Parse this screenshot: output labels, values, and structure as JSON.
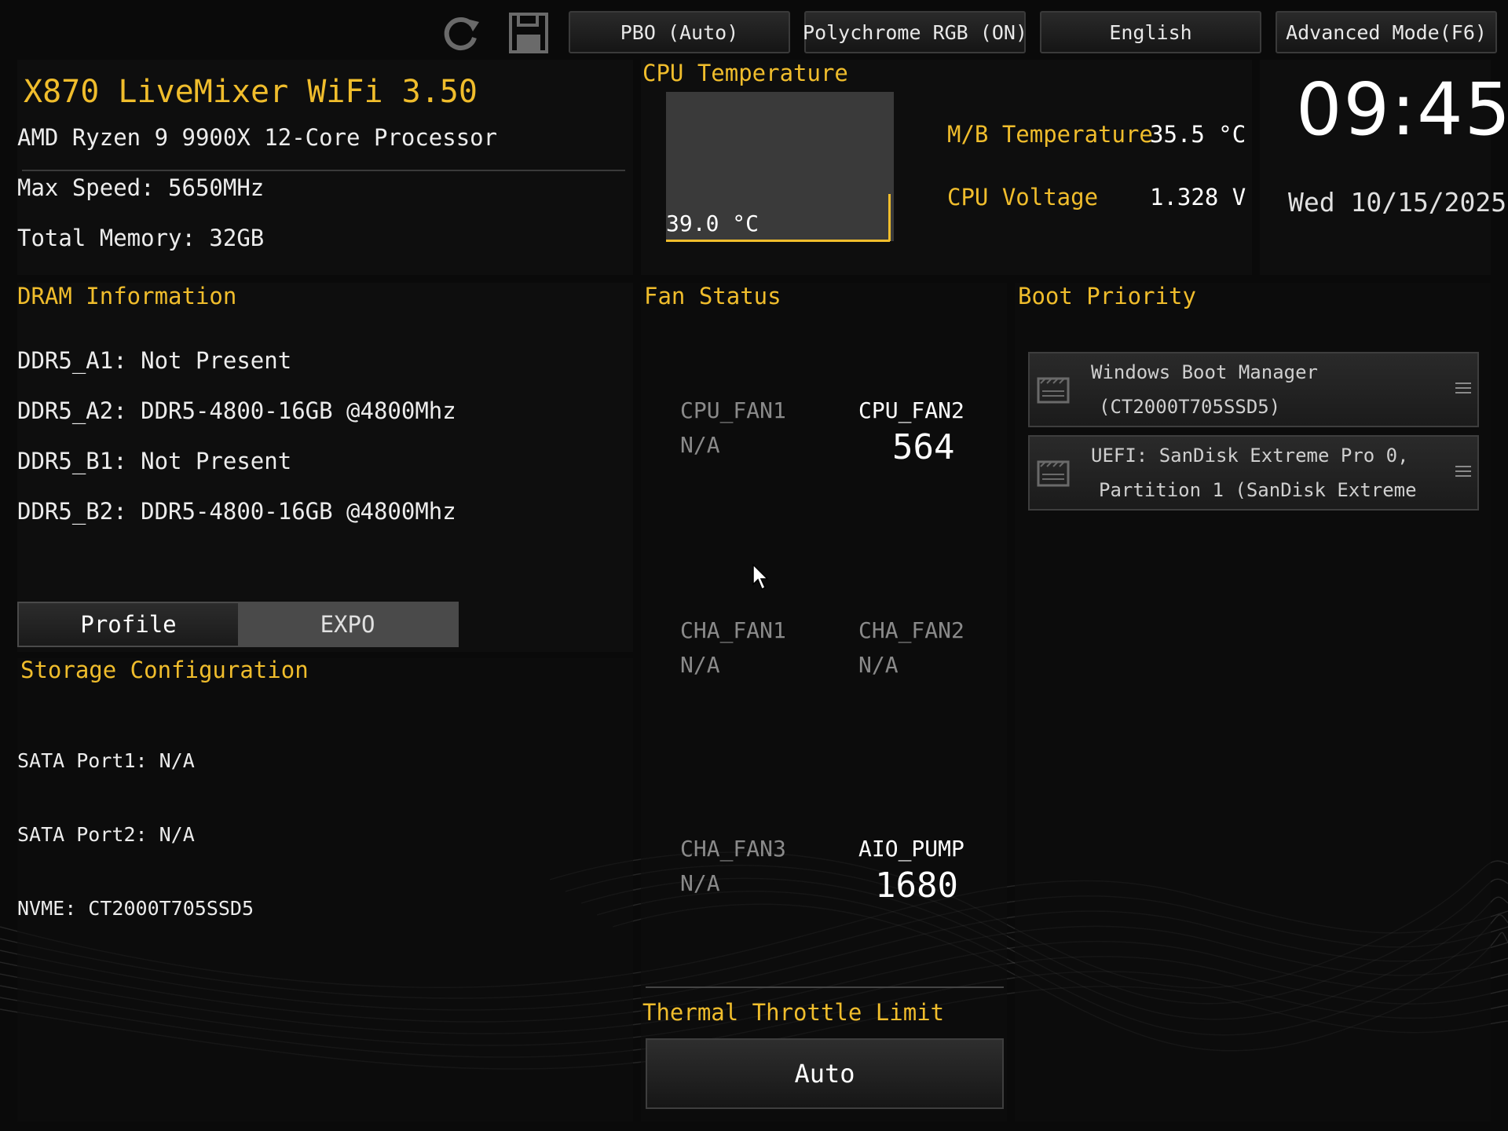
{
  "colors": {
    "accent": "#f0bd2c",
    "panel": "#0e0e0e",
    "background": "#0a0a0a"
  },
  "toolbar": {
    "icons": [
      "refresh-icon",
      "save-icon"
    ],
    "pbo": "PBO (Auto)",
    "rgb": "Polychrome RGB (ON)",
    "language": "English",
    "advanced": "Advanced Mode(F6)"
  },
  "system": {
    "board": "X870 LiveMixer WiFi 3.50",
    "cpu": "AMD Ryzen 9 9900X 12-Core Processor",
    "max_speed": "Max Speed: 5650MHz",
    "memory": "Total Memory: 32GB"
  },
  "cpu_temp": {
    "title": "CPU Temperature",
    "value": "39.0 °C"
  },
  "readouts": {
    "mb_label": "M/B Temperature",
    "mb_value": "35.5 °C",
    "volt_label": "CPU Voltage",
    "volt_value": "1.328 V"
  },
  "clock": {
    "time": "09:45",
    "date": "Wed 10/15/2025"
  },
  "dram": {
    "title": "DRAM Information",
    "slots": [
      "DDR5_A1: Not Present",
      "DDR5_A2: DDR5-4800-16GB @4800Mhz",
      "DDR5_B1: Not Present",
      "DDR5_B2: DDR5-4800-16GB @4800Mhz"
    ],
    "profile_label": "Profile",
    "profile_value": "EXPO"
  },
  "storage": {
    "title": "Storage Configuration",
    "ports": [
      "SATA Port1: N/A",
      "SATA Port2: N/A",
      "NVME: CT2000T705SSD5"
    ]
  },
  "fans": {
    "title": "Fan Status",
    "items": [
      {
        "name": "CPU_FAN1",
        "value": "N/A"
      },
      {
        "name": "CPU_FAN2",
        "value": "564"
      },
      {
        "name": "CHA_FAN1",
        "value": "N/A"
      },
      {
        "name": "CHA_FAN2",
        "value": "N/A"
      },
      {
        "name": "CHA_FAN3",
        "value": "N/A"
      },
      {
        "name": "AIO_PUMP",
        "value": "1680"
      }
    ]
  },
  "boot": {
    "title": "Boot Priority",
    "items": [
      {
        "line1": "Windows Boot Manager",
        "line2": "(CT2000T705SSD5)"
      },
      {
        "line1": "UEFI: SanDisk Extreme Pro 0,",
        "line2": "Partition 1 (SanDisk Extreme"
      }
    ]
  },
  "throttle": {
    "title": "Thermal Throttle Limit",
    "value": "Auto"
  }
}
